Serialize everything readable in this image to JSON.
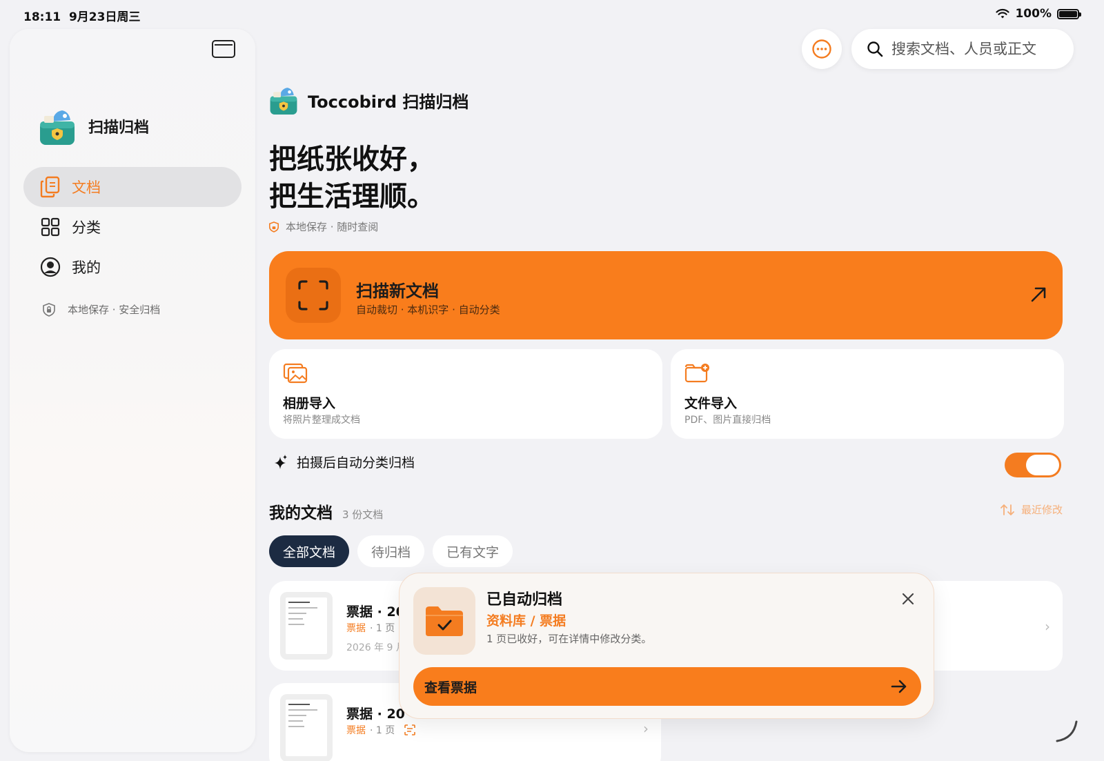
{
  "status_bar": {
    "time": "18:11",
    "date": "9月23日周三",
    "battery": "100%"
  },
  "sidebar": {
    "brand_name": "扫描归档",
    "nav": [
      {
        "label": "文档",
        "icon": "documents-icon",
        "active": true
      },
      {
        "label": "分类",
        "icon": "grid-icon",
        "active": false
      },
      {
        "label": "我的",
        "icon": "profile-icon",
        "active": false
      }
    ],
    "note": "本地保存 · 安全归档"
  },
  "search": {
    "placeholder": "搜索文档、人员或正文"
  },
  "header": {
    "app_title": "Toccobird 扫描归档",
    "headline_line1": "把纸张收好，",
    "headline_line2": "把生活理顺。",
    "subnote": "本地保存 · 随时查阅"
  },
  "scan": {
    "title": "扫描新文档",
    "subtitle": "自动裁切 · 本机识字 · 自动分类"
  },
  "imports": [
    {
      "title": "相册导入",
      "subtitle": "将照片整理成文档",
      "icon": "photo-album-icon"
    },
    {
      "title": "文件导入",
      "subtitle": "PDF、图片直接归档",
      "icon": "folder-add-icon"
    }
  ],
  "auto_classify": {
    "label": "拍摄后自动分类归档",
    "enabled": true
  },
  "documents": {
    "title": "我的文档",
    "count": "3 份文档",
    "sort_label": "最近修改",
    "filters": [
      {
        "label": "全部文档",
        "active": true
      },
      {
        "label": "待归档",
        "active": false
      },
      {
        "label": "已有文字",
        "active": false
      }
    ],
    "items": [
      {
        "title": "票据 · 20",
        "tag": "票据",
        "pages": "· 1 页",
        "date": "2026 年 9 月"
      },
      {
        "title": "票据 · 20",
        "tag": "票据",
        "pages": "· 1 页",
        "date": ""
      }
    ]
  },
  "toast": {
    "title": "已自动归档",
    "path": "资料库 / 票据",
    "description": "1 页已收好，可在详情中修改分类。",
    "button_label": "查看票据"
  },
  "colors": {
    "accent": "#f97d1c",
    "dark_chip": "#1c2b42",
    "background": "#f2f2f5"
  }
}
